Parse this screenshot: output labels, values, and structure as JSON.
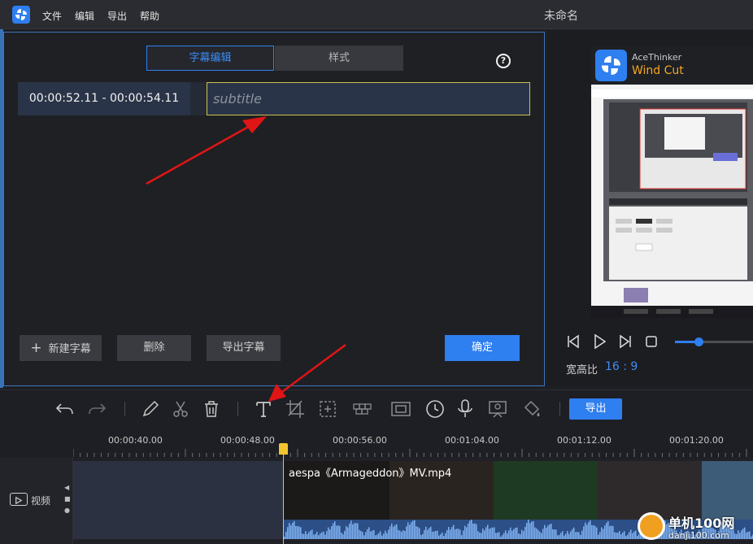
{
  "window": {
    "title": "未命名"
  },
  "menu": [
    "文件",
    "编辑",
    "导出",
    "帮助"
  ],
  "editor": {
    "tabs": {
      "edit": "字幕编辑",
      "style": "样式"
    },
    "help": "?",
    "row": {
      "time_range": "00:00:52.11 - 00:00:54.11",
      "text_value": "",
      "text_placeholder": "subtitle"
    },
    "buttons": {
      "new": "新建字幕",
      "delete": "删除",
      "export": "导出字幕",
      "ok": "确定"
    }
  },
  "preview": {
    "brand_name": "AceThinker",
    "product": "Wind Cut",
    "aspect_label": "宽高比",
    "aspect_value": "16 : 9",
    "progress": 0.3
  },
  "toolbar": {
    "export_label": "导出"
  },
  "ruler": [
    "00:00:40.00",
    "00:00:48.00",
    "00:00:56.00",
    "00:01:04.00",
    "00:01:12.00",
    "00:01:20.00"
  ],
  "track": {
    "label": "视频",
    "clip_name": "aespa《Armageddon》MV.mp4"
  },
  "watermark": {
    "site": "单机100网",
    "url": "danji100.com"
  },
  "colors": {
    "accent": "#2e7ff0",
    "playhead": "#f2c530",
    "annotation": "#e01515"
  }
}
